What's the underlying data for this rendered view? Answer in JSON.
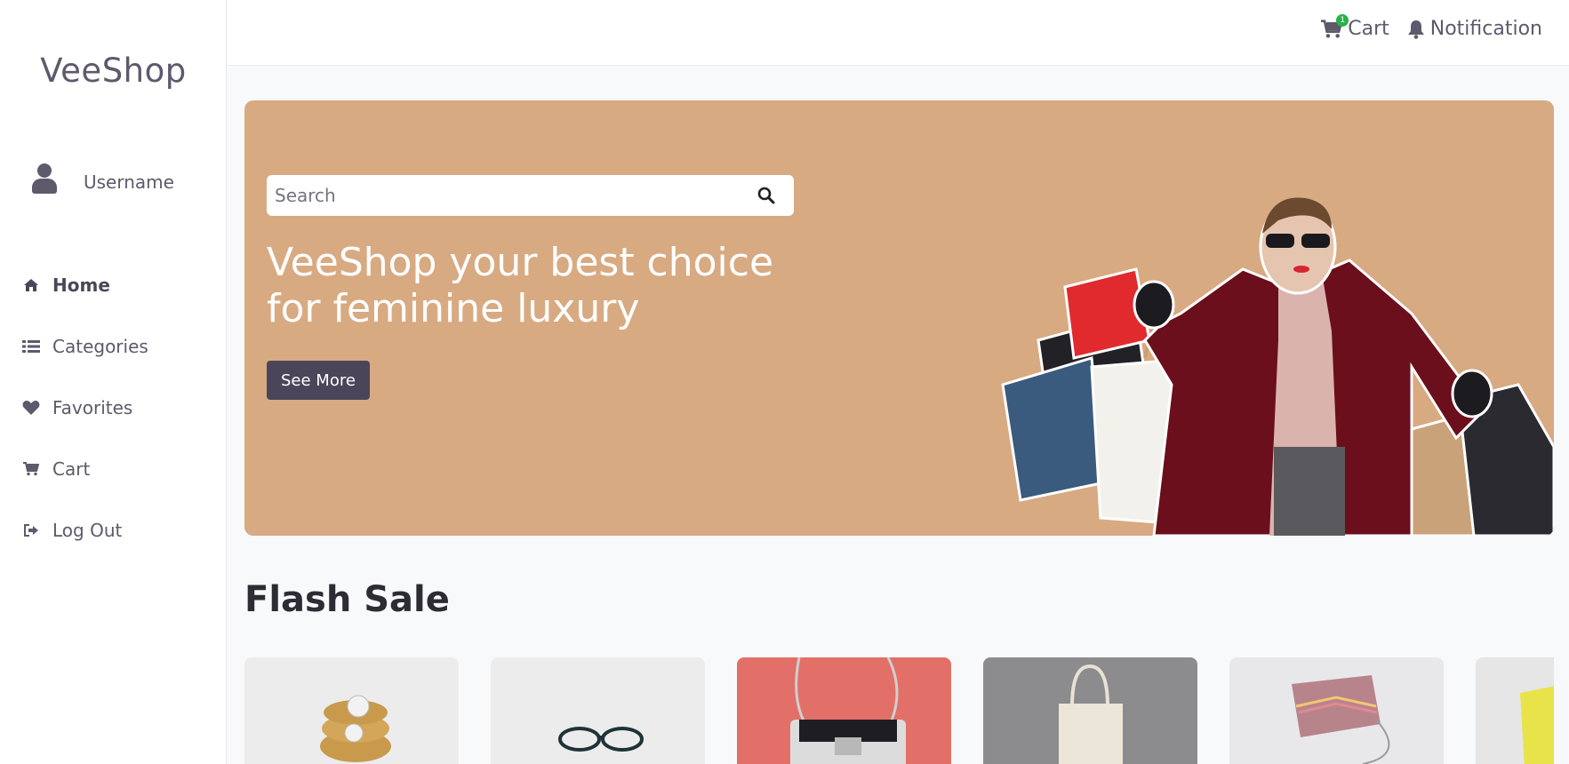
{
  "app": {
    "logo": "VeeShop"
  },
  "user": {
    "name": "Username"
  },
  "sidebar": {
    "items": [
      {
        "label": "Home",
        "icon": "home-icon",
        "active": true
      },
      {
        "label": "Categories",
        "icon": "list-icon"
      },
      {
        "label": "Favorites",
        "icon": "heart-icon"
      },
      {
        "label": "Cart",
        "icon": "cart-icon"
      },
      {
        "label": "Log Out",
        "icon": "logout-icon"
      }
    ]
  },
  "topbar": {
    "cart_label": "Cart",
    "cart_count": "1",
    "notification_label": "Notification"
  },
  "hero": {
    "search_placeholder": "Search",
    "title": "VeeShop your best choice for feminine luxury",
    "button_label": "See More",
    "background_color": "#d8aa82"
  },
  "flash_sale": {
    "title": "Flash Sale",
    "products": [
      {
        "name": "rings",
        "bg": "#ececed"
      },
      {
        "name": "glasses",
        "bg": "#ececec"
      },
      {
        "name": "handbag",
        "bg": "#e27068"
      },
      {
        "name": "tote bag",
        "bg": "#8c8c8e"
      },
      {
        "name": "purse",
        "bg": "#e8e8ea"
      },
      {
        "name": "yellow item",
        "bg": "#e6e6e6"
      }
    ]
  },
  "colors": {
    "accent": "#4b4559",
    "badge": "#27b14a",
    "text": "#5e596b"
  }
}
